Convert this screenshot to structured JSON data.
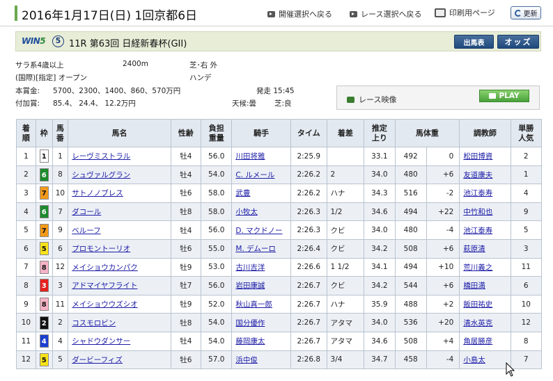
{
  "header": {
    "title": "2016年1月17日(日) 1回京都6日",
    "nav_meeting": "開催選択へ戻る",
    "nav_race": "レース選択へ戻る",
    "print": "印刷用ページ",
    "refresh": "更新"
  },
  "race": {
    "logo_text": "WIN",
    "logo_num": "5",
    "win5_leg": "⑤",
    "name": "11R 第63回 日経新春杯(GII)",
    "btn_entries": "出馬表",
    "btn_odds": "オッズ",
    "class": "サラ系4歳以上",
    "distance": "2400m",
    "course": "芝･右 外",
    "conditions": "(国際)[指定] オープン",
    "weight_rule": "ハンデ",
    "prize_label": "本賞金:",
    "prize_values": "5700、2300、1400、860、570万円",
    "add_prize_label": "付加賞:",
    "add_prize_values": "85.4、 24.4、 12.2万円",
    "post_time": "発走 15:45",
    "weather": "天候:曇",
    "going": "芝:良",
    "video_label": "レース映像",
    "play_label": "PLAY"
  },
  "table": {
    "headers": [
      "着\n順",
      "枠",
      "馬\n番",
      "馬名",
      "性齢",
      "負担\n重量",
      "騎手",
      "タイム",
      "着差",
      "推定\n上り",
      "馬体重",
      "",
      "調教師",
      "単勝\n人気"
    ],
    "waku_colors": {
      "1": {
        "bg": "#ffffff",
        "fg": "#111111"
      },
      "2": {
        "bg": "#111111",
        "fg": "#ffffff"
      },
      "3": {
        "bg": "#e5211f",
        "fg": "#ffffff"
      },
      "4": {
        "bg": "#1c3fd0",
        "fg": "#ffffff"
      },
      "5": {
        "bg": "#f7e21a",
        "fg": "#111111"
      },
      "6": {
        "bg": "#1e8a2e",
        "fg": "#ffffff"
      },
      "7": {
        "bg": "#f39a1a",
        "fg": "#111111"
      },
      "8": {
        "bg": "#f6b3c6",
        "fg": "#111111"
      }
    },
    "rows": [
      {
        "rank": "1",
        "waku": "1",
        "num": "1",
        "horse": "レーヴミストラル",
        "sex_age": "牡4",
        "weight": "56.0",
        "jockey": "川田将雅",
        "time": "2:25.9",
        "margin": "",
        "last3f": "33.1",
        "body": "492",
        "diff": "0",
        "trainer": "松田博資",
        "pop": "2"
      },
      {
        "rank": "2",
        "waku": "6",
        "num": "8",
        "horse": "シュヴァルグラン",
        "sex_age": "牡4",
        "weight": "54.0",
        "jockey": "C. ルメール",
        "time": "2:26.2",
        "margin": "2",
        "last3f": "34.0",
        "body": "480",
        "diff": "+6",
        "trainer": "友道康夫",
        "pop": "1"
      },
      {
        "rank": "3",
        "waku": "7",
        "num": "10",
        "horse": "サトノノブレス",
        "sex_age": "牡6",
        "weight": "58.0",
        "jockey": "武豊",
        "time": "2:26.2",
        "margin": "ハナ",
        "last3f": "34.3",
        "body": "516",
        "diff": "-2",
        "trainer": "池江泰寿",
        "pop": "4"
      },
      {
        "rank": "4",
        "waku": "6",
        "num": "7",
        "horse": "ダコール",
        "sex_age": "牡8",
        "weight": "58.0",
        "jockey": "小牧太",
        "time": "2:26.3",
        "margin": "1/2",
        "last3f": "34.6",
        "body": "494",
        "diff": "+22",
        "trainer": "中竹和也",
        "pop": "9"
      },
      {
        "rank": "5",
        "waku": "7",
        "num": "9",
        "horse": "ベルーフ",
        "sex_age": "牡4",
        "weight": "56.0",
        "jockey": "D. マクドノー",
        "time": "2:26.3",
        "margin": "クビ",
        "last3f": "34.0",
        "body": "480",
        "diff": "-4",
        "trainer": "池江泰寿",
        "pop": "5"
      },
      {
        "rank": "6",
        "waku": "5",
        "num": "6",
        "horse": "プロモントーリオ",
        "sex_age": "牡6",
        "weight": "55.0",
        "jockey": "M. デムーロ",
        "time": "2:26.4",
        "margin": "クビ",
        "last3f": "34.2",
        "body": "508",
        "diff": "+6",
        "trainer": "萩原清",
        "pop": "3"
      },
      {
        "rank": "7",
        "waku": "8",
        "num": "12",
        "horse": "メイショウカンパク",
        "sex_age": "牡9",
        "weight": "53.0",
        "jockey": "古川吉洋",
        "time": "2:26.6",
        "margin": "1 1/2",
        "last3f": "34.1",
        "body": "494",
        "diff": "+10",
        "trainer": "荒川義之",
        "pop": "11"
      },
      {
        "rank": "8",
        "waku": "3",
        "num": "3",
        "horse": "アドマイヤフライト",
        "sex_age": "牡7",
        "weight": "56.0",
        "jockey": "岩田康誠",
        "time": "2:26.7",
        "margin": "クビ",
        "last3f": "34.2",
        "body": "544",
        "diff": "+6",
        "trainer": "橋田満",
        "pop": "6"
      },
      {
        "rank": "9",
        "waku": "8",
        "num": "11",
        "horse": "メイショウウズシオ",
        "sex_age": "牡9",
        "weight": "52.0",
        "jockey": "秋山真一郎",
        "time": "2:26.7",
        "margin": "ハナ",
        "last3f": "35.9",
        "body": "488",
        "diff": "+2",
        "trainer": "飯田祐史",
        "pop": "10"
      },
      {
        "rank": "10",
        "waku": "2",
        "num": "2",
        "horse": "コスモロビン",
        "sex_age": "牡8",
        "weight": "54.0",
        "jockey": "国分優作",
        "time": "2:26.7",
        "margin": "アタマ",
        "last3f": "34.0",
        "body": "536",
        "diff": "+20",
        "trainer": "清水英克",
        "pop": "12"
      },
      {
        "rank": "11",
        "waku": "4",
        "num": "4",
        "horse": "シャドウダンサー",
        "sex_age": "牡4",
        "weight": "54.0",
        "jockey": "藤岡康太",
        "time": "2:26.7",
        "margin": "アタマ",
        "last3f": "34.6",
        "body": "508",
        "diff": "+4",
        "trainer": "角居勝彦",
        "pop": "8"
      },
      {
        "rank": "12",
        "waku": "5",
        "num": "5",
        "horse": "ダービーフィズ",
        "sex_age": "牡6",
        "weight": "57.0",
        "jockey": "浜中俊",
        "time": "2:26.8",
        "margin": "3/4",
        "last3f": "34.7",
        "body": "458",
        "diff": "-4",
        "trainer": "小島太",
        "pop": "7"
      }
    ]
  }
}
